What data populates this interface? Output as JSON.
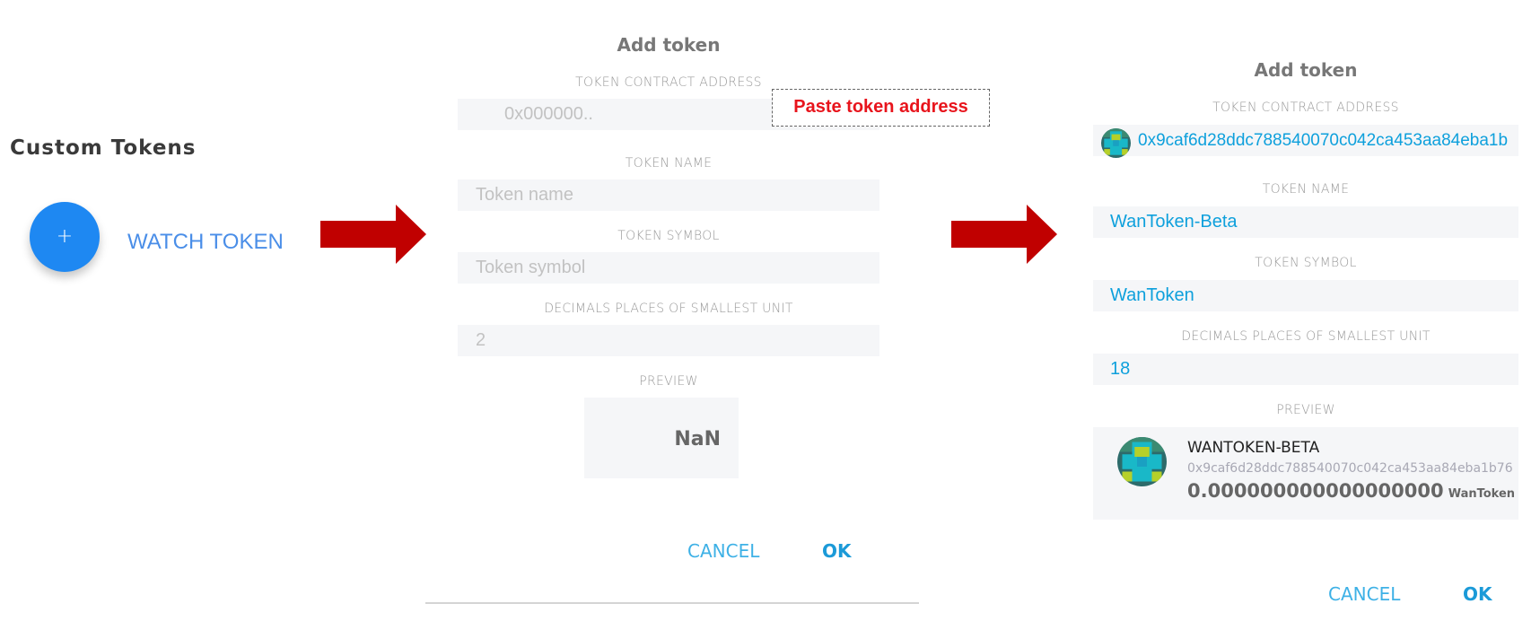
{
  "colors": {
    "accent": "#1e88f2",
    "arrow": "#c00000",
    "value_text": "#0ea0dc",
    "callout_red": "#e8141c"
  },
  "left": {
    "section_title": "Custom Tokens",
    "add_button_icon": "+",
    "watch_token_label": "WATCH TOKEN"
  },
  "dialog1": {
    "title": "Add token",
    "contract_label": "TOKEN CONTRACT ADDRESS",
    "contract_placeholder": "0x000000..",
    "callout": "Paste token address",
    "name_label": "TOKEN NAME",
    "name_placeholder": "Token name",
    "symbol_label": "TOKEN SYMBOL",
    "symbol_placeholder": "Token symbol",
    "decimals_label": "DECIMALS PLACES OF SMALLEST UNIT",
    "decimals_placeholder": "2",
    "preview_label": "PREVIEW",
    "preview_value": "NaN",
    "cancel": "CANCEL",
    "ok": "OK"
  },
  "dialog2": {
    "title": "Add token",
    "contract_label": "TOKEN CONTRACT ADDRESS",
    "contract_value": "0x9caf6d28ddc788540070c042ca453aa84eba1b",
    "name_label": "TOKEN NAME",
    "name_value": "WanToken-Beta",
    "symbol_label": "TOKEN SYMBOL",
    "symbol_value": "WanToken",
    "decimals_label": "DECIMALS PLACES OF SMALLEST UNIT",
    "decimals_value": "18",
    "preview_label": "PREVIEW",
    "preview_name": "WANTOKEN-BETA",
    "preview_address": "0x9caf6d28ddc788540070c042ca453aa84eba1b76",
    "preview_balance": "0.000000000000000000",
    "preview_unit": "WanToken",
    "cancel": "CANCEL",
    "ok": "OK"
  }
}
